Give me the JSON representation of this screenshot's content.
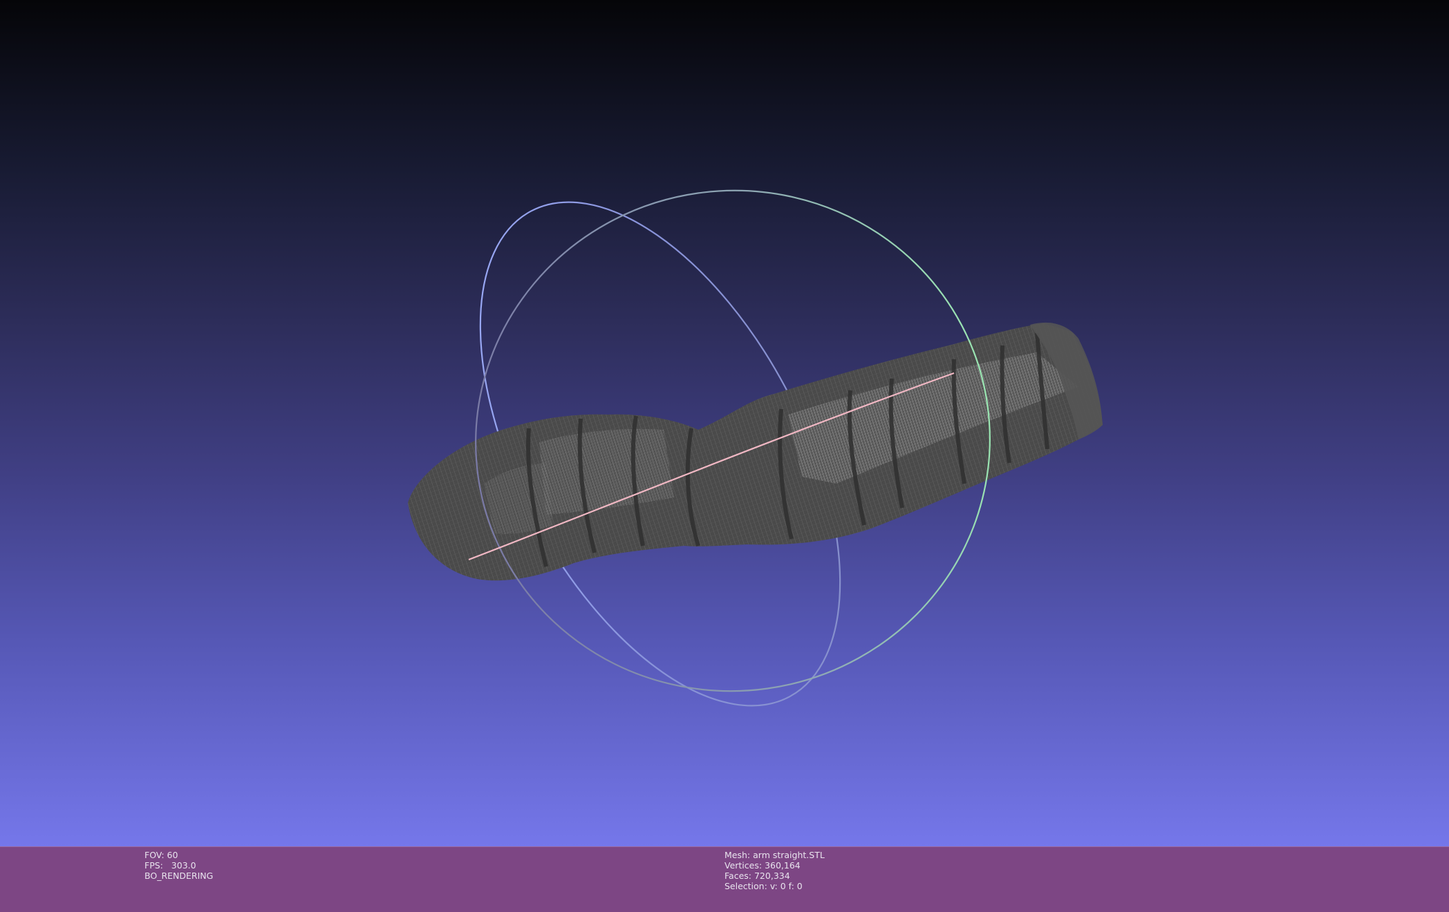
{
  "viewer": {
    "colors": {
      "background_top": "#050508",
      "background_bottom": "#7577ea",
      "info_bar": "#7d4684",
      "mesh": "#4b4b4b",
      "trackball_x": "#a7b0f0",
      "trackball_y": "#93e0b4",
      "trackball_z": "#f0b8c4"
    }
  },
  "info_left": {
    "fov_label": "FOV:",
    "fov_value": "60",
    "fps_label": "FPS:",
    "fps_value": "303.0",
    "render_mode": "BO_RENDERING"
  },
  "info_right": {
    "mesh_label": "Mesh:",
    "mesh_name": "arm straight.STL",
    "vertices_label": "Vertices:",
    "vertices_value": "360,164",
    "faces_label": "Faces:",
    "faces_value": "720,334",
    "selection_label": "Selection:",
    "selection_value": "v: 0 f: 0"
  }
}
